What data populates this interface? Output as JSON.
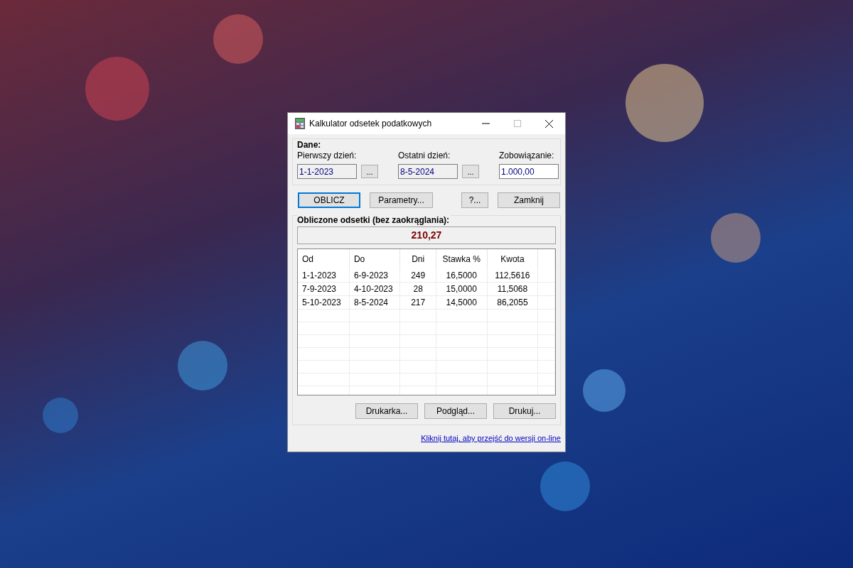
{
  "window": {
    "title": "Kalkulator odsetek podatkowych"
  },
  "data_group": {
    "title": "Dane:",
    "fields": [
      {
        "label": "Pierwszy dzień:",
        "value": "1-1-2023",
        "readonly": true,
        "picker": "..."
      },
      {
        "label": "Ostatni dzień:",
        "value": "8-5-2024",
        "readonly": true,
        "picker": "..."
      },
      {
        "label": "Zobowiązanie:",
        "value": "1.000,00",
        "readonly": false
      }
    ]
  },
  "actions": [
    {
      "label": "OBLICZ",
      "default": true
    },
    {
      "label": "Parametry...",
      "default": false
    },
    {
      "label": "?...",
      "default": false
    },
    {
      "label": "Zamknij",
      "default": false
    }
  ],
  "result_group": {
    "title": "Obliczone odsetki (bez zaokrąglania):",
    "total": "210,27",
    "table": {
      "columns": [
        "Od",
        "Do",
        "Dni",
        "Stawka %",
        "Kwota"
      ],
      "rows": [
        [
          "1-1-2023",
          "6-9-2023",
          "249",
          "16,5000",
          "112,5616"
        ],
        [
          "7-9-2023",
          "4-10-2023",
          "28",
          "15,0000",
          "11,5068"
        ],
        [
          "5-10-2023",
          "8-5-2024",
          "217",
          "14,5000",
          "86,2055"
        ]
      ]
    },
    "print_buttons": [
      "Drukarka...",
      "Podgląd...",
      "Drukuj..."
    ]
  },
  "link": "Kliknij tutaj, aby przejść do wersji on-line"
}
